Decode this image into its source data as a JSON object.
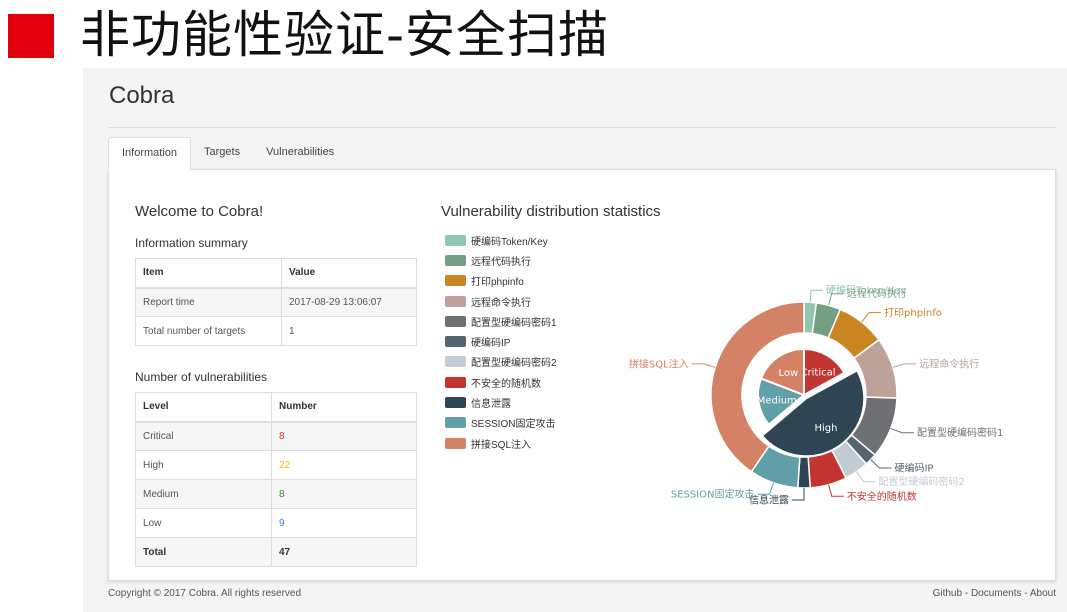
{
  "slide": {
    "title": "非功能性验证-安全扫描",
    "marker_color": "#e0000b"
  },
  "app": {
    "title": "Cobra",
    "tabs": [
      {
        "label": "Information",
        "active": true
      },
      {
        "label": "Targets",
        "active": false
      },
      {
        "label": "Vulnerabilities",
        "active": false
      }
    ]
  },
  "info": {
    "welcome": "Welcome to Cobra!",
    "summary_title": "Information summary",
    "summary_headers": [
      "Item",
      "Value"
    ],
    "summary_rows": [
      [
        "Report time",
        "2017-08-29 13:06:07"
      ],
      [
        "Total number of targets",
        "1"
      ]
    ],
    "vuln_title": "Number of vulnerabilities",
    "vuln_headers": [
      "Level",
      "Number"
    ],
    "vuln_rows": [
      {
        "level": "Critical",
        "number": "8",
        "color": "#d9342b"
      },
      {
        "level": "High",
        "number": "22",
        "color": "#f0c400"
      },
      {
        "level": "Medium",
        "number": "8",
        "color": "#2e8b2e"
      },
      {
        "level": "Low",
        "number": "9",
        "color": "#3a7fd5"
      },
      {
        "level": "Total",
        "number": "47",
        "color": "#333333"
      }
    ]
  },
  "chart_data": {
    "type": "pie",
    "title": "Vulnerability distribution statistics",
    "inner": [
      {
        "name": "Critical",
        "value": 8,
        "color": "#c23531"
      },
      {
        "name": "High",
        "value": 22,
        "color": "#2f4554"
      },
      {
        "name": "Medium",
        "value": 8,
        "color": "#61a0a8"
      },
      {
        "name": "Low",
        "value": 9,
        "color": "#d48265"
      }
    ],
    "outer": [
      {
        "name": "硬编码Token/Key",
        "value": 1,
        "color": "#91c7ae"
      },
      {
        "name": "远程代码执行",
        "value": 2,
        "color": "#749f83"
      },
      {
        "name": "打印phpinfo",
        "value": 4,
        "color": "#ca8622"
      },
      {
        "name": "远程命令执行",
        "value": 5,
        "color": "#bda29a"
      },
      {
        "name": "配置型硬编码密码1",
        "value": 5,
        "color": "#6e7074"
      },
      {
        "name": "硬编码IP",
        "value": 1,
        "color": "#546570"
      },
      {
        "name": "配置型硬编码密码2",
        "value": 2,
        "color": "#c4ccd3"
      },
      {
        "name": "不安全的随机数",
        "value": 3,
        "color": "#c23531"
      },
      {
        "name": "信息泄露",
        "value": 1,
        "color": "#2f4554"
      },
      {
        "name": "SESSION固定攻击",
        "value": 4,
        "color": "#61a0a8"
      },
      {
        "name": "拼接SQL注入",
        "value": 19,
        "color": "#d48265"
      }
    ]
  },
  "footer": {
    "copyright": "Copyright © 2017 Cobra. All rights reserved",
    "links": [
      "Github",
      "Documents",
      "About"
    ],
    "separator": " - "
  }
}
